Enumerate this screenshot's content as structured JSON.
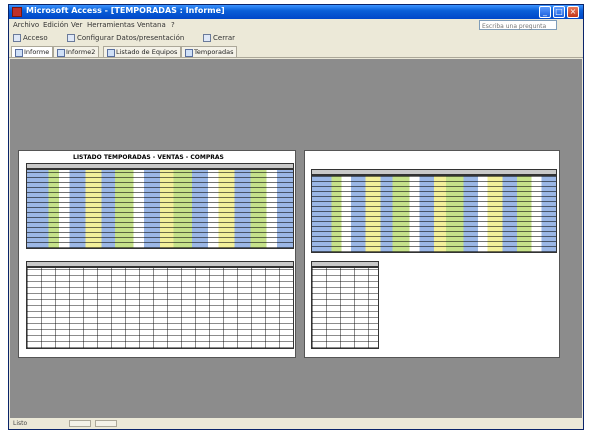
{
  "window": {
    "title": "Microsoft Access - [TEMPORADAS : Informe]",
    "controls": {
      "minimize": "_",
      "maximize": "□",
      "close": "×"
    }
  },
  "menu": {
    "items": [
      "Archivo",
      "Edición",
      "Ver",
      "Herramientas",
      "Ventana",
      "?"
    ],
    "help_placeholder": "Escriba una pregunta"
  },
  "toolbar": {
    "items": [
      "Acceso",
      "Configurar Datos/presentación",
      "Cerrar"
    ]
  },
  "tabs": [
    "Informe",
    "Informe2",
    "Listado de Equipos",
    "Temporadas"
  ],
  "report": {
    "title": "LISTADO TEMPORADAS - VENTAS - COMPRAS"
  },
  "statusbar": {
    "text": "Listo"
  },
  "colors": {
    "titlebar": "#0a5fd8",
    "preview_bg": "#8c8c8c",
    "cell_blue": "#9bb7e6",
    "cell_green": "#c6e28a",
    "cell_yellow": "#f3f09a"
  }
}
